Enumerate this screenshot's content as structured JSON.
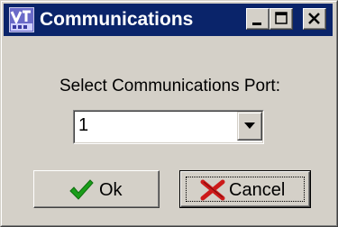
{
  "window": {
    "title": "Communications",
    "title_icon": "vb-app-icon",
    "controls": {
      "minimize_icon": "minimize-icon",
      "maximize_icon": "maximize-icon",
      "close_icon": "close-icon"
    },
    "colors": {
      "titlebar": "#0a246a",
      "face": "#d4d0c8"
    }
  },
  "dialog": {
    "prompt": "Select Communications Port:",
    "port_select": {
      "value": "1",
      "arrow_icon": "dropdown-arrow-icon"
    },
    "ok_button": {
      "label": "Ok",
      "icon": "checkmark-icon",
      "icon_color": "#1a9e1a"
    },
    "cancel_button": {
      "label": "Cancel",
      "icon": "red-x-icon",
      "icon_color": "#cc1a1a",
      "focused": true
    }
  }
}
